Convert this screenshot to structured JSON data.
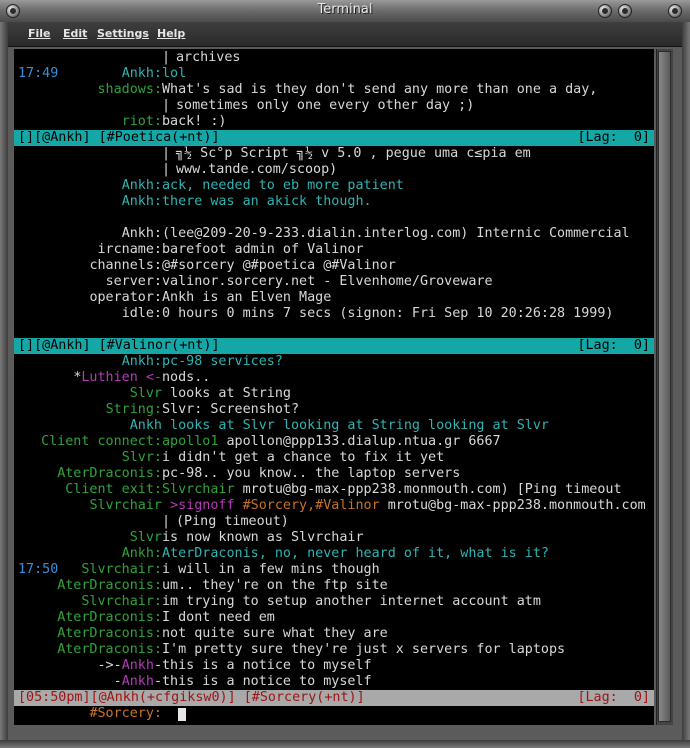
{
  "window": {
    "title": "Terminal"
  },
  "menu": {
    "file": "File",
    "edit": "Edit",
    "settings": "Settings",
    "help": "Help"
  },
  "lines": [
    {
      "pipe": "|",
      "text": "archives"
    },
    {
      "ts": "17:49",
      "nick": "Ankh:",
      "nick_color": "cy",
      "text": "lol",
      "text_color": "cy"
    },
    {
      "nick": "shadows:",
      "nick_color": "gr",
      "text": "What's sad is they don't send any more than one a day,"
    },
    {
      "pipe": "|",
      "text": "sometimes only one every other day ;)"
    },
    {
      "nick": "riot:",
      "nick_color": "gr",
      "text": "back! :)"
    },
    {
      "status_left": "[][@Ankh] [#Poetica(+nt)]",
      "status_right": "[Lag:  0]"
    },
    {
      "pipe": "|",
      "text": "╗½ Sc°p Script ╗½ v 5.0 , pegue uma c≤pia em"
    },
    {
      "pipe": "|",
      "text": "www.tande.com/scoop)"
    },
    {
      "nick": "Ankh:",
      "nick_color": "cy",
      "text": "ack, needed to eb more patient",
      "text_color": "cy"
    },
    {
      "nick": "Ankh:",
      "nick_color": "cy",
      "text": "there was an akick though.",
      "text_color": "cy"
    },
    {},
    {
      "nick": "Ankh:",
      "nick_color": "wh",
      "text": "(lee@209-20-9-233.dialin.interlog.com) Internic Commercial"
    },
    {
      "nick": "ircname:",
      "nick_color": "wh",
      "text": "barefoot admin of Valinor"
    },
    {
      "nick": "channels:",
      "nick_color": "wh",
      "text": "@#sorcery @#poetica @#Valinor"
    },
    {
      "nick": "server:",
      "nick_color": "wh",
      "text": "valinor.sorcery.net - Elvenhome/Groveware"
    },
    {
      "nick": "operator:",
      "nick_color": "wh",
      "text": "Ankh is an Elven Mage"
    },
    {
      "nick": "idle:",
      "nick_color": "wh",
      "text": "0 hours 0 mins 7 secs (signon: Fri Sep 10 20:26:28 1999)"
    },
    {},
    {
      "status_left": "[][@Ankh] [#Valinor(+nt)]",
      "status_right": "[Lag:  0]"
    },
    {
      "nick": "Ankh:",
      "nick_color": "cy",
      "text": "pc-98 services?",
      "text_color": "cy"
    },
    {
      "nick_parts": [
        [
          "*",
          "wh"
        ],
        [
          "Luthien",
          "mg"
        ],
        [
          " <-",
          "mg"
        ]
      ],
      "text": "nods.."
    },
    {
      "nick": "Slvr",
      "nick_color": "gr",
      "text": " looks at String"
    },
    {
      "nick": "String:",
      "nick_color": "gr",
      "text": "Slvr: Screenshot?"
    },
    {
      "nick": "Ankh",
      "nick_color": "cy",
      "text": " looks at Slvr looking at String looking at Slvr",
      "text_color": "cy"
    },
    {
      "nick": "Client connect:",
      "nick_color": "gr",
      "text_parts": [
        [
          "apollo1",
          "gr"
        ],
        [
          " apollon@ppp133.dialup.ntua.gr 6667",
          "wh"
        ]
      ]
    },
    {
      "nick": "Slvr:",
      "nick_color": "gr",
      "text": "i didn't get a chance to fix it yet"
    },
    {
      "nick": "AterDraconis:",
      "nick_color": "gr",
      "text": "pc-98.. you know.. the laptop servers"
    },
    {
      "nick": "Client exit:",
      "nick_color": "gr",
      "text_parts": [
        [
          "Slvrchair",
          "gr"
        ],
        [
          " mrotu@bg-max-ppp238.monmouth.com) [Ping timeout",
          "wh"
        ]
      ]
    },
    {
      "nick": "Slvrchair",
      "nick_color": "gr",
      "text_parts": [
        [
          " >signoff",
          "mg"
        ],
        [
          " #Sorcery,#Valinor",
          "or"
        ],
        [
          " mrotu@bg-max-ppp238.monmouth.com",
          "wh"
        ]
      ]
    },
    {
      "pipe": "|",
      "text": "(Ping timeout)"
    },
    {
      "nick": "Slvr",
      "nick_color": "gr",
      "text": "is now known as Slvrchair"
    },
    {
      "nick": "Ankh:",
      "nick_color": "gr",
      "text": "AterDraconis, no, never heard of it, what is it?",
      "text_color": "cy"
    },
    {
      "ts": "17:50",
      "nick": "Slvrchair:",
      "nick_color": "gr",
      "text": "i will in a few mins though"
    },
    {
      "nick": "AterDraconis:",
      "nick_color": "gr",
      "text": "um.. they're on the ftp site"
    },
    {
      "nick": "Slvrchair:",
      "nick_color": "gr",
      "text": "im trying to setup another internet account atm"
    },
    {
      "nick": "AterDraconis:",
      "nick_color": "gr",
      "text": "I dont need em"
    },
    {
      "nick": "AterDraconis:",
      "nick_color": "gr",
      "text": "not quite sure what they are"
    },
    {
      "nick": "AterDraconis:",
      "nick_color": "gr",
      "text": "I'm pretty sure they're just x servers for laptops"
    },
    {
      "nick_parts": [
        [
          "->-",
          "wh"
        ],
        [
          "Ankh",
          "mg"
        ],
        [
          "-",
          "wh"
        ]
      ],
      "text": "this is a notice to myself"
    },
    {
      "nick_parts": [
        [
          "-",
          "wh"
        ],
        [
          "Ankh",
          "mg"
        ],
        [
          "-",
          "wh"
        ]
      ],
      "text": "this is a notice to myself"
    },
    {
      "status_left": "[05:50pm][@Ankh(+cfgiksw0)] [#Sorcery(+nt)]",
      "status_right": "[Lag:  0]",
      "status_style": "gray"
    },
    {
      "prompt": "#Sorcery:",
      "prompt_color": "or"
    }
  ]
}
